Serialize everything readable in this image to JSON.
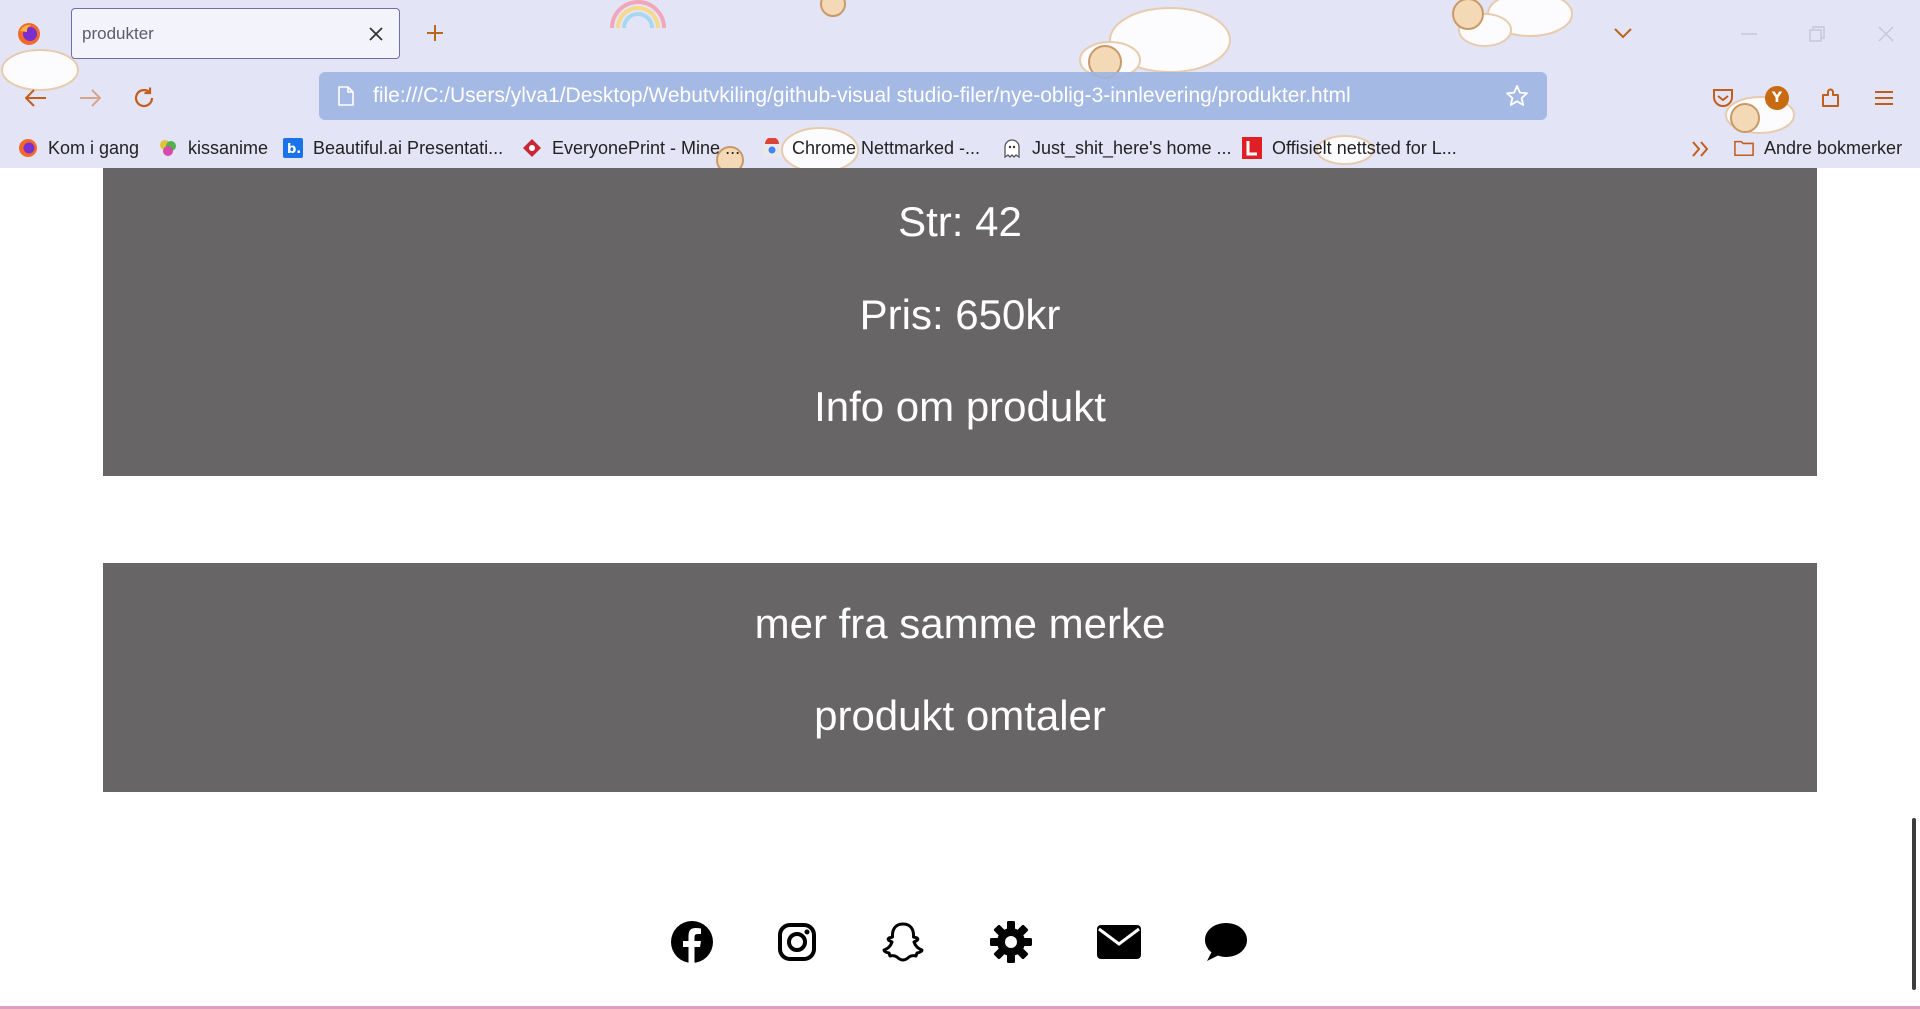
{
  "browser": {
    "tab": {
      "title": "produkter"
    },
    "url": "file:///C:/Users/ylva1/Desktop/Webutvkiling/github-visual studio-filer/nye-oblig-3-innlevering/produkter.html",
    "profile_initial": "Y",
    "bookmarks": [
      {
        "label": "Kom i gang",
        "icon": "firefox-icon"
      },
      {
        "label": "kissanime",
        "icon": "kissanime-icon"
      },
      {
        "label": "Beautiful.ai Presentati...",
        "icon": "beautiful-ai-icon"
      },
      {
        "label": "EveryonePrint - Mine ...",
        "icon": "everyoneprint-icon"
      },
      {
        "label": "Chrome Nettmarked -...",
        "icon": "chrome-webstore-icon"
      },
      {
        "label": "Just_shit_here's home ...",
        "icon": "ghost-icon"
      },
      {
        "label": "Offisielt nettsted for L...",
        "icon": "l-logo-icon"
      }
    ],
    "other_bookmarks": "Andre bokmerker"
  },
  "page": {
    "product": {
      "size": "Str: 42",
      "price": "Pris: 650kr",
      "info": "Info om produkt"
    },
    "more": {
      "same_brand": "mer fra samme merke",
      "reviews": "produkt omtaler"
    },
    "social_icons": [
      "facebook-icon",
      "instagram-icon",
      "snapchat-icon",
      "gear-icon",
      "mail-icon",
      "chat-icon"
    ]
  },
  "colors": {
    "panel_bg": "#676566",
    "panel_text": "#ffffff",
    "chrome_bg": "#e4e4f7",
    "urlbar_bg": "#9db4e2",
    "accent": "#c76a12"
  }
}
